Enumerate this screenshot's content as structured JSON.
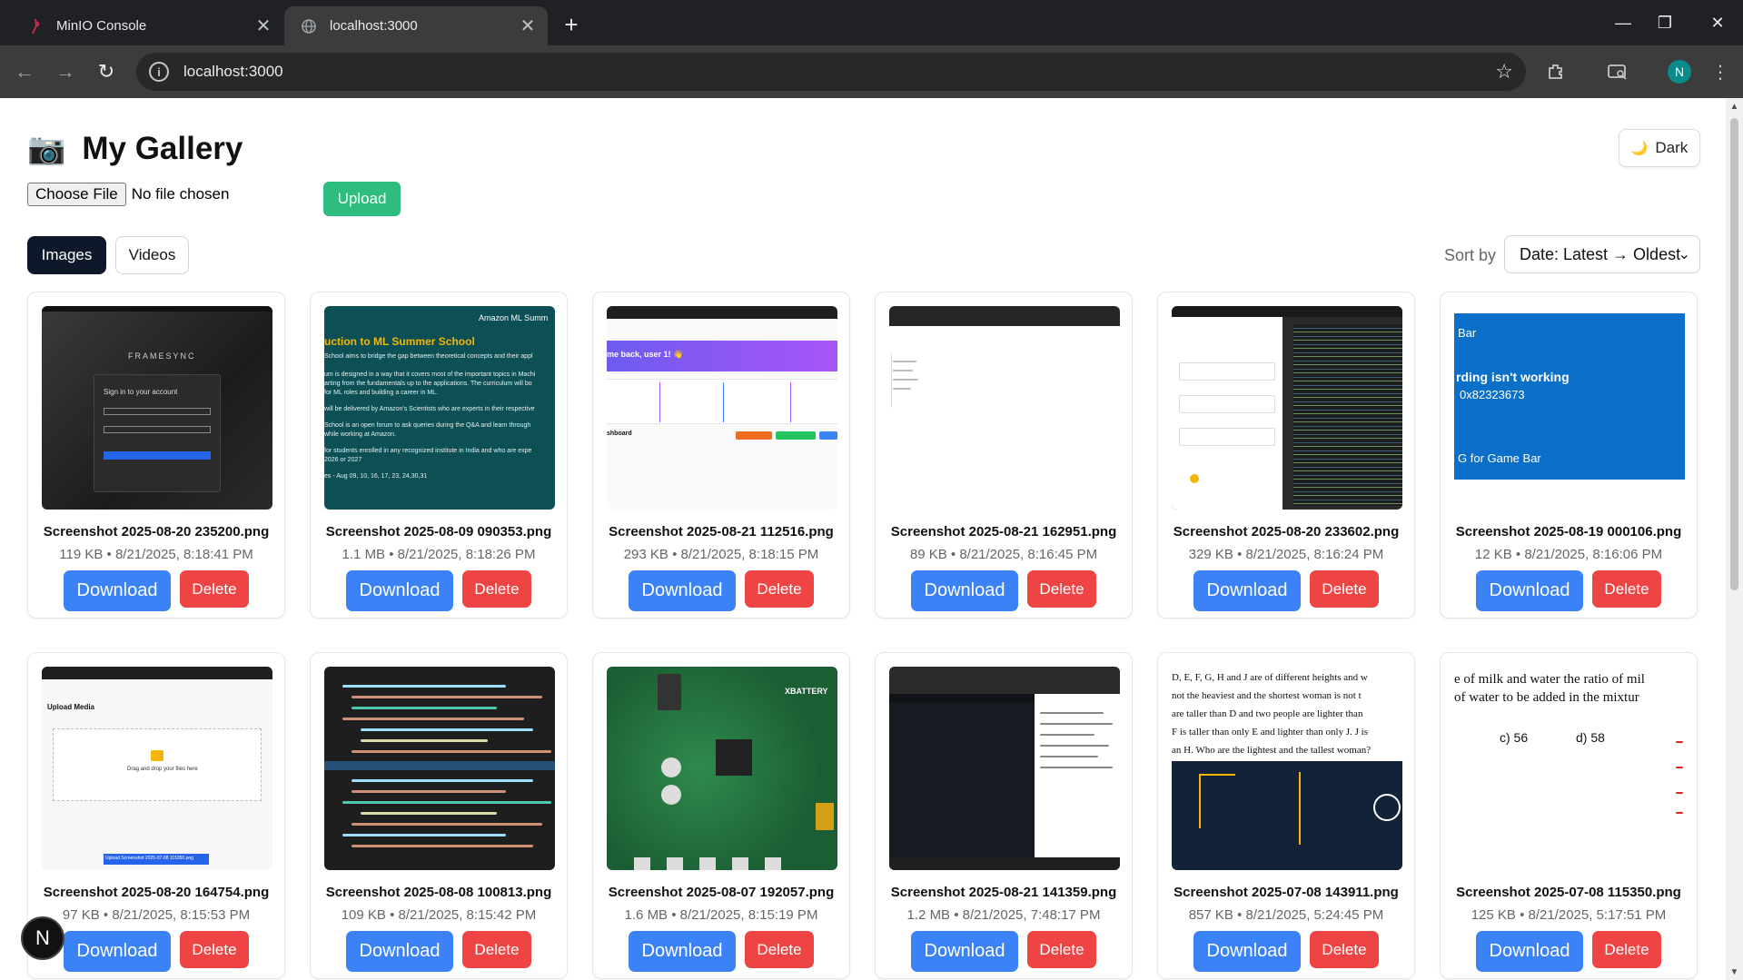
{
  "browser": {
    "tabs": [
      {
        "title": "MinIO Console",
        "icon": "minio-flamingo-icon",
        "active": false
      },
      {
        "title": "localhost:3000",
        "icon": "globe-icon",
        "active": true
      }
    ],
    "url": "localhost:3000",
    "profile_initial": "N"
  },
  "page": {
    "title": "My Gallery",
    "theme_button": "Dark",
    "file_input_button": "Choose File",
    "file_input_status": "No file chosen",
    "upload_button": "Upload",
    "tabs": [
      "Images",
      "Videos"
    ],
    "active_tab": "Images",
    "sort_label": "Sort by",
    "sort_value": "Date: Latest → Oldest",
    "fab_initial": "N"
  },
  "gallery": [
    {
      "name": "Screenshot 2025-08-20 235200.png",
      "meta": "119 KB • 8/21/2025, 8:18:41 PM",
      "download": "Download",
      "delete": "Delete"
    },
    {
      "name": "Screenshot 2025-08-09 090353.png",
      "meta": "1.1 MB • 8/21/2025, 8:18:26 PM",
      "download": "Download",
      "delete": "Delete"
    },
    {
      "name": "Screenshot 2025-08-21 112516.png",
      "meta": "293 KB • 8/21/2025, 8:18:15 PM",
      "download": "Download",
      "delete": "Delete"
    },
    {
      "name": "Screenshot 2025-08-21 162951.png",
      "meta": "89 KB • 8/21/2025, 8:16:45 PM",
      "download": "Download",
      "delete": "Delete"
    },
    {
      "name": "Screenshot 2025-08-20 233602.png",
      "meta": "329 KB • 8/21/2025, 8:16:24 PM",
      "download": "Download",
      "delete": "Delete"
    },
    {
      "name": "Screenshot 2025-08-19 000106.png",
      "meta": "12 KB • 8/21/2025, 8:16:06 PM",
      "download": "Download",
      "delete": "Delete"
    },
    {
      "name": "Screenshot 2025-08-20 164754.png",
      "meta": "97 KB • 8/21/2025, 8:15:53 PM",
      "download": "Download",
      "delete": "Delete"
    },
    {
      "name": "Screenshot 2025-08-08 100813.png",
      "meta": "109 KB • 8/21/2025, 8:15:42 PM",
      "download": "Download",
      "delete": "Delete"
    },
    {
      "name": "Screenshot 2025-08-07 192057.png",
      "meta": "1.6 MB • 8/21/2025, 8:15:19 PM",
      "download": "Download",
      "delete": "Delete"
    },
    {
      "name": "Screenshot 2025-08-21 141359.png",
      "meta": "1.2 MB • 8/21/2025, 7:48:17 PM",
      "download": "Download",
      "delete": "Delete"
    },
    {
      "name": "Screenshot 2025-07-08 143911.png",
      "meta": "857 KB • 8/21/2025, 5:24:45 PM",
      "download": "Download",
      "delete": "Delete"
    },
    {
      "name": "Screenshot 2025-07-08 115350.png",
      "meta": "125 KB • 8/21/2025, 5:17:51 PM",
      "download": "Download",
      "delete": "Delete"
    }
  ],
  "thumb_text": {
    "t1_brand": "FRAMESYNC",
    "t1_signin": "Sign in to your account",
    "t2_org": "Amazon ML Summ",
    "t2_heading": "uction to ML Summer School",
    "t2_l1": "School aims to bridge the gap between theoretical concepts and their appl",
    "t2_l2": "um is designed in a way that it covers most of the important topics in Machi",
    "t2_l3": "arting from the fundamentals up to the applications. The curriculum will bo",
    "t2_l4": "for ML roles and building a career in ML.",
    "t2_l5": "will be delivered by Amazon's Scientists who are experts in their respective",
    "t2_l6": "School is an open forum to ask queries during the Q&A and learn through",
    "t2_l7": "while working at Amazon.",
    "t2_l8": "for students enrolled in any recognized institute in India and who are expe",
    "t2_l9": "2026 or 2027",
    "t2_l10": "es - Aug 09, 10, 16, 17, 23, 24,30,31",
    "t3_banner": "me back, user 1! 👋",
    "t3_section": "shboard",
    "t6_bar": "Bar",
    "t6_msg": "rding isn't working",
    "t6_code": "0x82323673",
    "t6_hint": "G for Game Bar",
    "t7_title": "Upload Media",
    "t7_drop": "Drag and drop your files here",
    "t7_btn": "Upload Screenshot 2025-07-08 115350.png",
    "t9_brand": "XBATTERY",
    "t11_l1": "D, E, F, G, H and J are of different heights and w",
    "t11_l2": "not the heaviest and the shortest woman is not t",
    "t11_l3": "are taller than D and two people are lighter than",
    "t11_l4": "F is taller than only E and lighter than only J. J is",
    "t11_l5": "an H. Who are the lightest and the tallest woman?",
    "t12_l1": "e of milk and water the ratio of mil",
    "t12_l2": "of water to be added in the mixtur",
    "t12_c": "c) 56",
    "t12_d": "d) 58"
  }
}
